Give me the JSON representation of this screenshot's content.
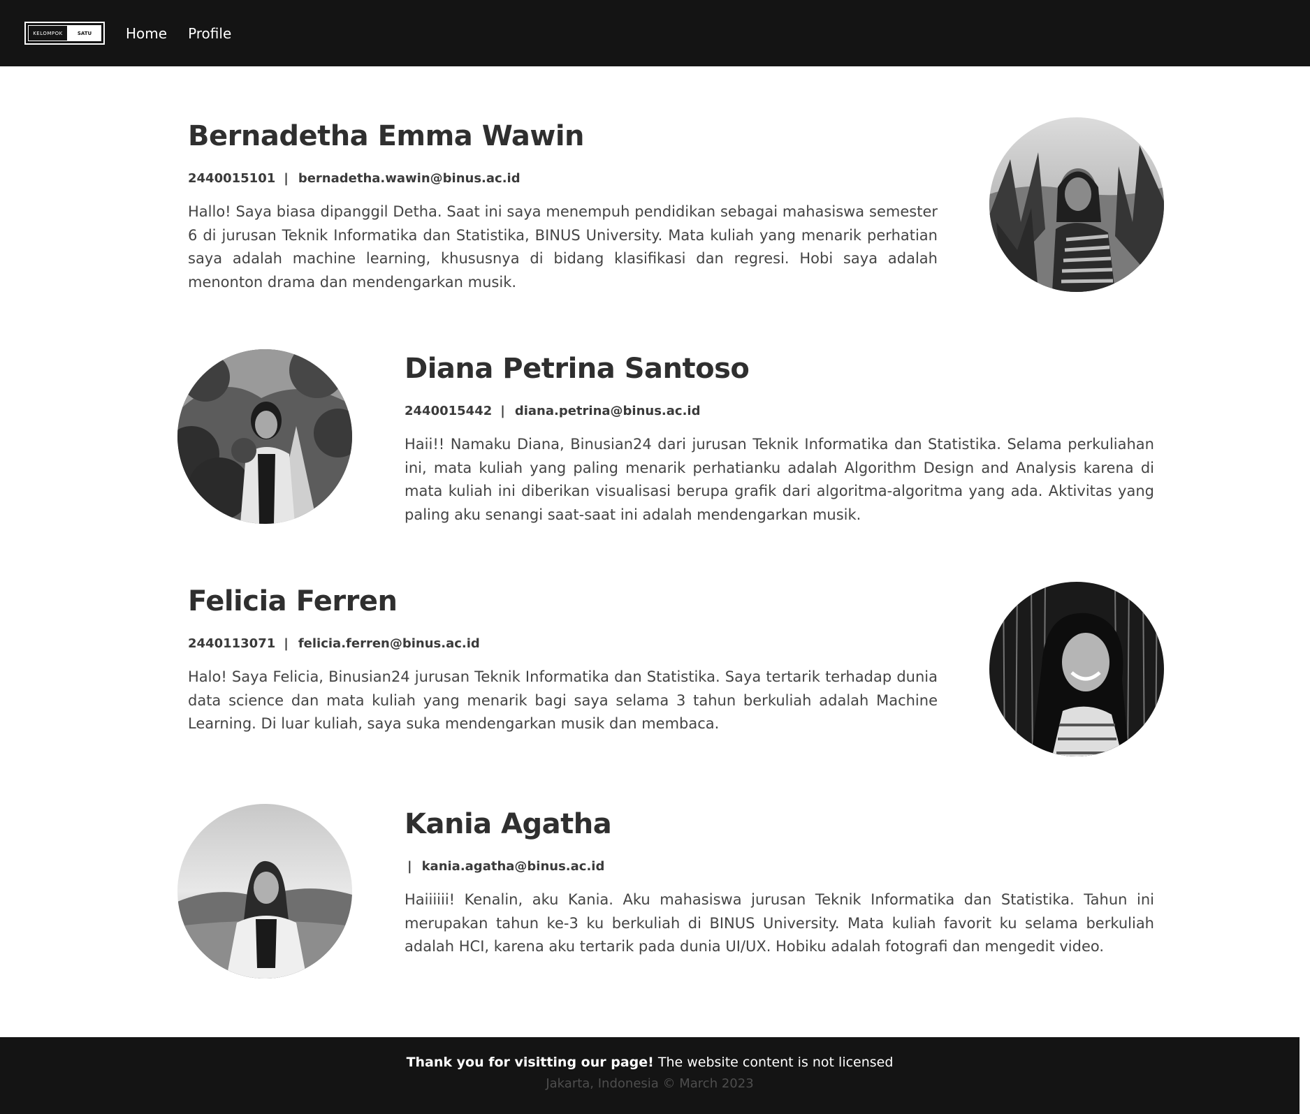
{
  "nav": {
    "logo_left": "KELOMPOK",
    "logo_right": "SATU",
    "links": [
      "Home",
      "Profile"
    ]
  },
  "profiles": [
    {
      "name": "Bernadetha Emma Wawin",
      "nim": "2440015101",
      "email": "bernadetha.wawin@binus.ac.id",
      "bio": "Hallo! Saya biasa dipanggil Detha. Saat ini saya menempuh pendidikan sebagai mahasiswa semester 6 di jurusan Teknik Informatika dan Statistika, BINUS University. Mata kuliah yang menarik perhatian saya adalah machine learning, khususnya di bidang klasifikasi dan regresi. Hobi saya adalah menonton drama dan mendengarkan musik."
    },
    {
      "name": "Diana Petrina Santoso",
      "nim": "2440015442",
      "email": "diana.petrina@binus.ac.id",
      "bio": "Haii!! Namaku Diana, Binusian24 dari jurusan Teknik Informatika dan Statistika. Selama perkuliahan ini, mata kuliah yang paling menarik perhatianku adalah Algorithm Design and Analysis karena di mata kuliah ini diberikan visualisasi berupa grafik dari algoritma-algoritma yang ada. Aktivitas yang paling aku senangi saat-saat ini adalah mendengarkan musik."
    },
    {
      "name": "Felicia Ferren",
      "nim": "2440113071",
      "email": "felicia.ferren@binus.ac.id",
      "bio": "Halo! Saya Felicia, Binusian24 jurusan Teknik Informatika dan Statistika. Saya tertarik terhadap dunia data science dan mata kuliah yang menarik bagi saya selama 3 tahun berkuliah adalah Machine Learning. Di luar kuliah, saya suka mendengarkan musik dan membaca."
    },
    {
      "name": "Kania Agatha",
      "nim": "",
      "email": "kania.agatha@binus.ac.id",
      "bio": "Haiiiiii! Kenalin, aku Kania. Aku mahasiswa jurusan Teknik Informatika dan Statistika. Tahun ini merupakan tahun ke-3 ku berkuliah di BINUS University. Mata kuliah favorit ku selama berkuliah adalah HCI, karena aku tertarik pada dunia UI/UX. Hobiku adalah fotografi dan mengedit video."
    }
  ],
  "meta_separator": "|",
  "footer": {
    "bold_text": "Thank you for visitting our page!",
    "text": "The website content is not licensed",
    "location": "Jakarta, Indonesia © March 2023"
  }
}
